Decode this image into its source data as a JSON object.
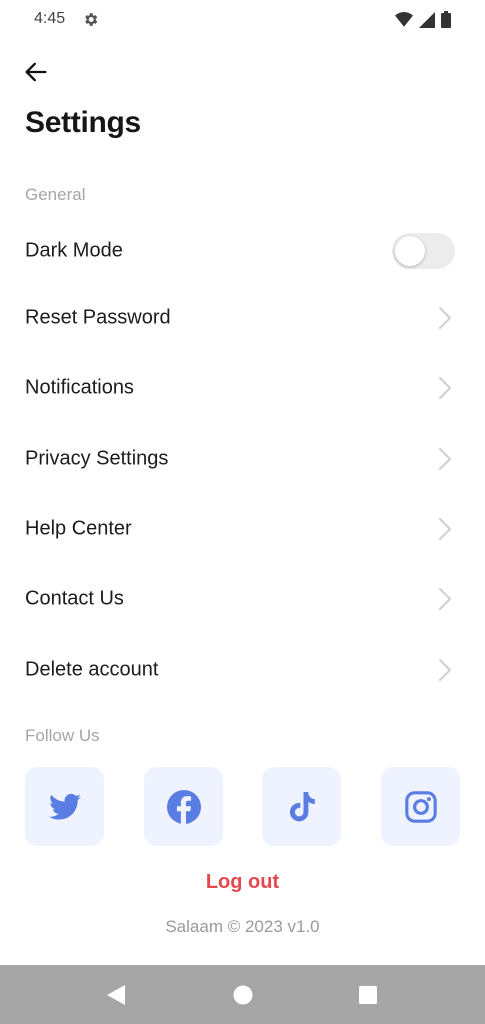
{
  "status_bar": {
    "time": "4:45"
  },
  "header": {
    "title": "Settings"
  },
  "sections": {
    "general": "General",
    "follow": "Follow Us"
  },
  "settings": {
    "dark_mode": {
      "label": "Dark Mode",
      "enabled": false
    },
    "items": [
      {
        "label": "Reset Password"
      },
      {
        "label": "Notifications"
      },
      {
        "label": "Privacy Settings"
      },
      {
        "label": "Help Center"
      },
      {
        "label": "Contact Us"
      },
      {
        "label": "Delete account"
      }
    ]
  },
  "social": [
    "twitter-icon",
    "facebook-icon",
    "tiktok-icon",
    "instagram-icon"
  ],
  "actions": {
    "logout": "Log out"
  },
  "footer": {
    "text": "Salaam © 2023 v1.0"
  },
  "colors": {
    "accent": "#5a7de3",
    "social_bg": "#eef3ff",
    "logout": "#e5484d",
    "toggle_off": "#ececec",
    "chevron": "#cfcfcf",
    "nav_bar": "#a6a6a6"
  }
}
